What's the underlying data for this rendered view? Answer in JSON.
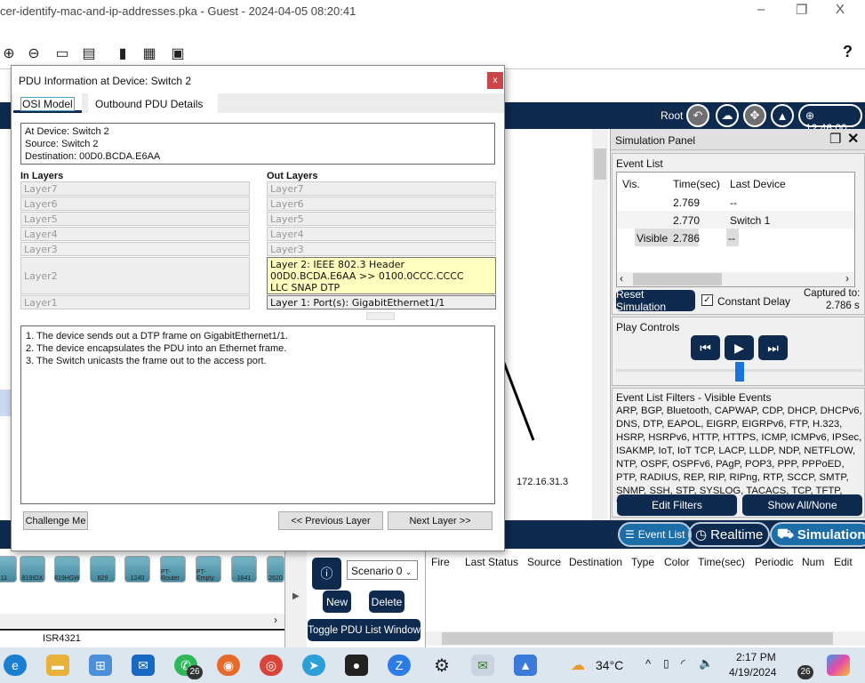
{
  "window": {
    "title": "cer-identify-mac-and-ip-addresses.pka - Guest - 2024-04-05 08:20:41",
    "minimize": "–",
    "restore": "❐",
    "close": "X"
  },
  "toolbar": {
    "icons": [
      "zoom-reset-icon",
      "zoom-out-icon",
      "window-icon",
      "palette-icon",
      "server-icon",
      "device-icon",
      "cloud-icon"
    ],
    "help": "?"
  },
  "topnav": {
    "root": "Root",
    "clock": "12:46:00"
  },
  "workspace": {
    "pc_label": "172.16.31.3",
    "partial_left": [
      "OU",
      "e F",
      "v",
      "he",
      "th",
      "ne",
      "ad",
      "n f",
      "A7"
    ]
  },
  "dialog": {
    "title": "PDU Information at Device: Switch 2",
    "close": "x",
    "tabs": [
      "OSI Model",
      "Outbound PDU Details"
    ],
    "info": [
      "At Device: Switch 2",
      "Source: Switch 2",
      "Destination: 00D0.BCDA.E6AA"
    ],
    "in_header": "In Layers",
    "out_header": "Out Layers",
    "in_layers": [
      "Layer7",
      "Layer6",
      "Layer5",
      "Layer4",
      "Layer3",
      "Layer2",
      "Layer1"
    ],
    "out_layers": [
      "Layer7",
      "Layer6",
      "Layer5",
      "Layer4",
      "Layer3"
    ],
    "out_layer2": [
      "Layer 2: IEEE 802.3 Header",
      "00D0.BCDA.E6AA >> 0100.0CCC.CCCC",
      "LLC SNAP DTP"
    ],
    "out_layer1": "Layer 1: Port(s): GigabitEthernet1/1",
    "description": [
      "1. The device sends out a DTP frame on GigabitEthernet1/1.",
      "2. The device encapsulates the PDU into an Ethernet frame.",
      "3. The Switch unicasts the frame out to the access port."
    ],
    "challenge": "Challenge Me",
    "prev": "<< Previous Layer",
    "next": "Next Layer >>"
  },
  "sim": {
    "title": "Simulation Panel",
    "event_list": "Event List",
    "cols": [
      "Vis.",
      "Time(sec)",
      "Last Device"
    ],
    "rows": [
      {
        "vis": "",
        "time": "2.769",
        "device": "--"
      },
      {
        "vis": "",
        "time": "2.770",
        "device": "Switch 1"
      },
      {
        "vis": "Visible",
        "time": "2.786",
        "device": "--"
      }
    ],
    "reset": "Reset Simulation",
    "constant_delay": "Constant Delay",
    "constant_delay_checked": true,
    "captured_label": "Captured to:",
    "captured_value": "2.786 s",
    "play_controls": "Play Controls",
    "filters_title": "Event List Filters - Visible Events",
    "filters": "ARP, BGP, Bluetooth, CAPWAP, CDP, DHCP, DHCPv6, DNS, DTP, EAPOL, EIGRP, EIGRPv6, FTP, H.323, HSRP, HSRPv6, HTTP, HTTPS, ICMP, ICMPv6, IPSec, ISAKMP, IoT, IoT TCP, LACP, LLDP, NDP, NETFLOW, NTP, OSPF, OSPFv6, PAgP, POP3, PPP, PPPoED, PTP, RADIUS, REP, RIP, RIPng, RTP, SCCP, SMTP, SNMP, SSH, STP, SYSLOG, TACACS, TCP, TFTP, Telnet, UDP, USB, VTP",
    "edit_filters": "Edit Filters",
    "show_all": "Show All/None"
  },
  "modes": {
    "event_list": "Event List",
    "realtime": "Realtime",
    "simulation": "Simulation"
  },
  "devices": {
    "items": [
      "11",
      "819IOX",
      "819HGW",
      "829",
      "1240",
      "PT-Router",
      "PT-Empty",
      "1841",
      "2620"
    ],
    "selected": "ISR4321"
  },
  "scenario": {
    "select": "Scenario 0",
    "new": "New",
    "delete": "Delete",
    "toggle": "Toggle PDU List Window"
  },
  "pdu_cols": [
    "Fire",
    "Last Status",
    "Source",
    "Destination",
    "Type",
    "Color",
    "Time(sec)",
    "Periodic",
    "Num",
    "Edit"
  ],
  "taskbar": {
    "whatsapp_badge": "26",
    "weather": "34°C",
    "time": "2:17 PM",
    "date": "4/19/2024",
    "notif": "26"
  },
  "colors": {
    "navy": "#0e2a4e",
    "highlight": "#ffffc0",
    "close": "#c9474a",
    "slider": "#1a73d9"
  }
}
